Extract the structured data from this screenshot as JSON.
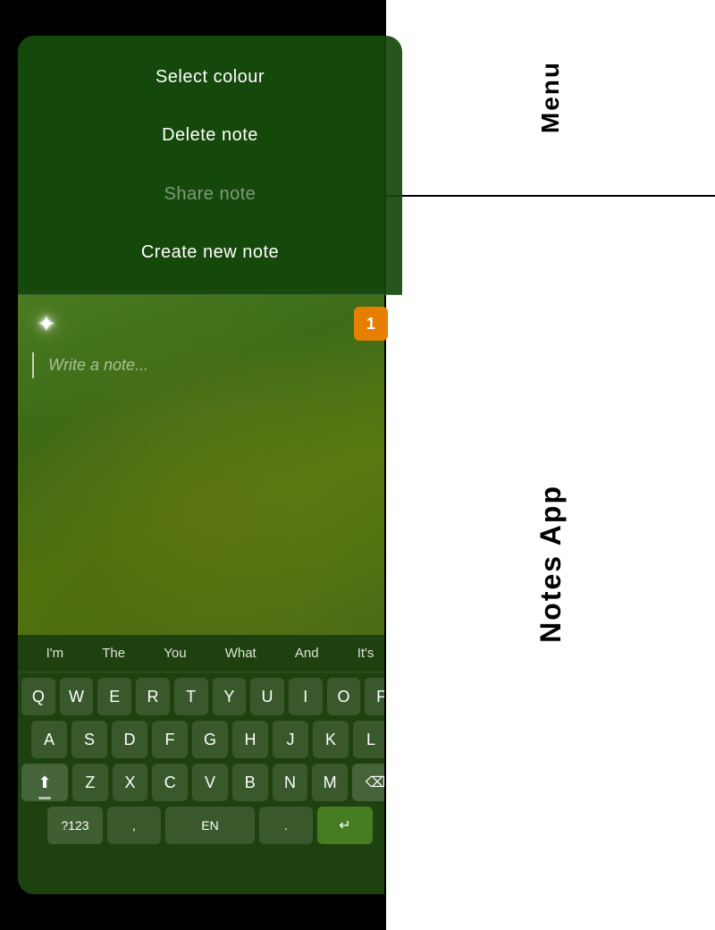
{
  "right_panel": {
    "top_label": "Menu",
    "bottom_label": "Notes App"
  },
  "menu": {
    "items": [
      {
        "label": "Select colour",
        "dimmed": false
      },
      {
        "label": "Delete note",
        "dimmed": false
      },
      {
        "label": "Share note",
        "dimmed": true
      },
      {
        "label": "Create new note",
        "dimmed": false
      }
    ]
  },
  "note": {
    "badge": "1",
    "placeholder": "Write a note..."
  },
  "keyboard": {
    "suggestions": [
      "I'm",
      "The",
      "You",
      "What",
      "And",
      "It's"
    ],
    "rows": [
      [
        "Q",
        "W",
        "E",
        "R",
        "T",
        "Y",
        "U",
        "I",
        "O",
        "P"
      ],
      [
        "A",
        "S",
        "D",
        "F",
        "G",
        "H",
        "J",
        "K",
        "L"
      ],
      [
        "Z",
        "X",
        "C",
        "V",
        "B",
        "N",
        "M"
      ],
      [
        "?123",
        ",",
        "EN",
        ".",
        "↵"
      ]
    ]
  }
}
